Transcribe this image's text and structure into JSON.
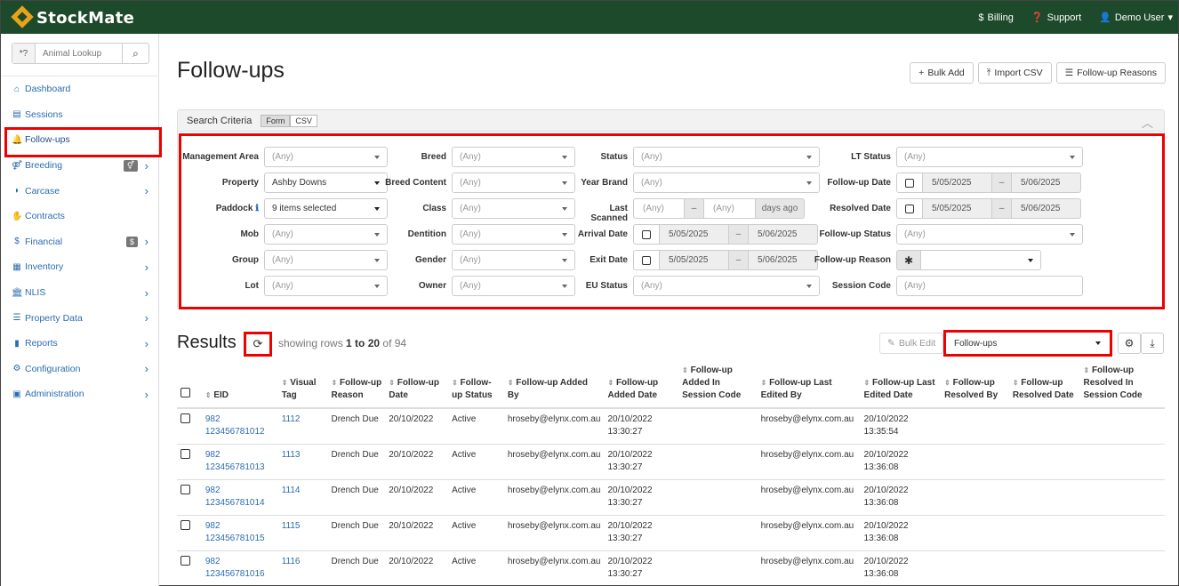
{
  "app": {
    "brand": "StockMate",
    "brand_accent": "#e8a21b",
    "topbar_color": "#1d4a2a"
  },
  "topnav": {
    "billing": "Billing",
    "support": "Support",
    "user": "Demo User"
  },
  "lookup": {
    "prefix": "*?",
    "placeholder": "Animal Lookup"
  },
  "sidebar": {
    "items": [
      {
        "label": "Dashboard",
        "icon": "home-icon"
      },
      {
        "label": "Sessions",
        "icon": "table-icon"
      },
      {
        "label": "Follow-ups",
        "icon": "bell-icon"
      },
      {
        "label": "Breeding",
        "icon": "gender-icon",
        "badge": "⚥"
      },
      {
        "label": "Carcase",
        "icon": "carcase-icon"
      },
      {
        "label": "Contracts",
        "icon": "handshake-icon"
      },
      {
        "label": "Financial",
        "icon": "dollar-icon",
        "badge": "$"
      },
      {
        "label": "Inventory",
        "icon": "inventory-icon"
      },
      {
        "label": "NLIS",
        "icon": "bank-icon"
      },
      {
        "label": "Property Data",
        "icon": "sliders-icon"
      },
      {
        "label": "Reports",
        "icon": "bar-chart-icon"
      },
      {
        "label": "Configuration",
        "icon": "gear-icon"
      },
      {
        "label": "Administration",
        "icon": "admin-icon"
      }
    ]
  },
  "page": {
    "title": "Follow-ups",
    "bulk_add": "Bulk Add",
    "import_csv": "Import CSV",
    "follow_up_reasons": "Follow-up Reasons"
  },
  "criteria": {
    "title": "Search Criteria",
    "form_tab": "Form",
    "csv_tab": "CSV",
    "any": "(Any)",
    "labels": {
      "management_area": "Management Area",
      "property": "Property",
      "paddock": "Paddock",
      "mob": "Mob",
      "group": "Group",
      "lot": "Lot",
      "breed": "Breed",
      "breed_content": "Breed Content",
      "class": "Class",
      "dentition": "Dentition",
      "gender": "Gender",
      "owner": "Owner",
      "status": "Status",
      "year_brand": "Year Brand",
      "last_scanned": "Last Scanned",
      "arrival_date": "Arrival Date",
      "exit_date": "Exit Date",
      "eu_status": "EU Status",
      "lt_status": "LT Status",
      "follow_up_date": "Follow-up Date",
      "resolved_date": "Resolved Date",
      "follow_up_status": "Follow-up Status",
      "follow_up_reason": "Follow-up Reason",
      "session_code": "Session Code"
    },
    "values": {
      "property": "Ashby Downs",
      "paddock": "9 items selected",
      "date_from": "5/05/2025",
      "date_to": "5/06/2025",
      "dash": "–",
      "days_ago": "days ago",
      "reason_prefix": "✱"
    }
  },
  "results": {
    "title": "Results",
    "showing_prefix": "showing rows",
    "range": "1 to 20",
    "of": "of 94",
    "bulk_edit": "Bulk Edit",
    "view": "Follow-ups",
    "columns": [
      "EID",
      "Visual Tag",
      "Follow-up Reason",
      "Follow-up Date",
      "Follow-up Status",
      "Follow-up Added By",
      "Follow-up Added Date",
      "Follow-up Added In Session Code",
      "Follow-up Last Edited By",
      "Follow-up Last Edited Date",
      "Follow-up Resolved By",
      "Follow-up Resolved Date",
      "Follow-up Resolved In Session Code"
    ],
    "rows": [
      {
        "eid1": "982",
        "eid2": "123456781012",
        "tag": "1112",
        "reason": "Drench Due",
        "date": "20/10/2022",
        "status": "Active",
        "added_by": "hroseby@elynx.com.au",
        "added_date1": "20/10/2022",
        "added_date2": "13:30:27",
        "edited_by": "hroseby@elynx.com.au",
        "edited_date1": "20/10/2022",
        "edited_date2": "13:35:54"
      },
      {
        "eid1": "982",
        "eid2": "123456781013",
        "tag": "1113",
        "reason": "Drench Due",
        "date": "20/10/2022",
        "status": "Active",
        "added_by": "hroseby@elynx.com.au",
        "added_date1": "20/10/2022",
        "added_date2": "13:30:27",
        "edited_by": "hroseby@elynx.com.au",
        "edited_date1": "20/10/2022",
        "edited_date2": "13:36:08"
      },
      {
        "eid1": "982",
        "eid2": "123456781014",
        "tag": "1114",
        "reason": "Drench Due",
        "date": "20/10/2022",
        "status": "Active",
        "added_by": "hroseby@elynx.com.au",
        "added_date1": "20/10/2022",
        "added_date2": "13:30:27",
        "edited_by": "hroseby@elynx.com.au",
        "edited_date1": "20/10/2022",
        "edited_date2": "13:36:08"
      },
      {
        "eid1": "982",
        "eid2": "123456781015",
        "tag": "1115",
        "reason": "Drench Due",
        "date": "20/10/2022",
        "status": "Active",
        "added_by": "hroseby@elynx.com.au",
        "added_date1": "20/10/2022",
        "added_date2": "13:30:27",
        "edited_by": "hroseby@elynx.com.au",
        "edited_date1": "20/10/2022",
        "edited_date2": "13:36:08"
      },
      {
        "eid1": "982",
        "eid2": "123456781016",
        "tag": "1116",
        "reason": "Drench Due",
        "date": "20/10/2022",
        "status": "Active",
        "added_by": "hroseby@elynx.com.au",
        "added_date1": "20/10/2022",
        "added_date2": "13:30:27",
        "edited_by": "hroseby@elynx.com.au",
        "edited_date1": "20/10/2022",
        "edited_date2": "13:36:08"
      }
    ]
  }
}
